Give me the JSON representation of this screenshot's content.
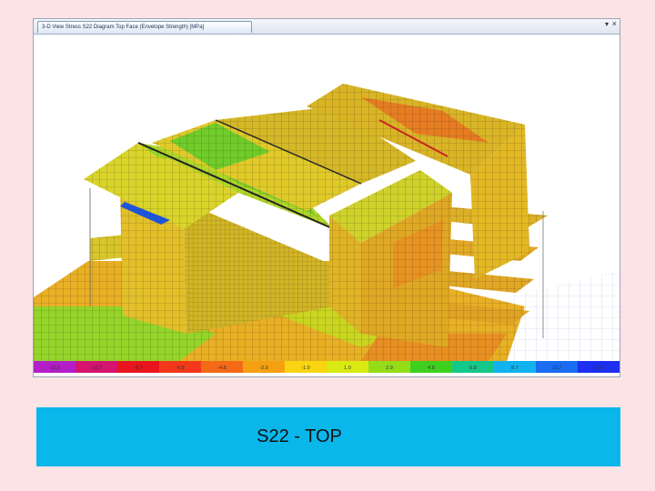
{
  "window": {
    "tab_label": "3-D View   Stress S22 Diagram  Top Face   (Envelope Strength)  [MPa]",
    "dropdown_glyph": "▾",
    "close_glyph": "×"
  },
  "legend": {
    "ticks": [
      "-12.0",
      "-10.2",
      "-8.7",
      "-6.8",
      "-4.8",
      "-2.9",
      "-1.0",
      "1.0",
      "2.9",
      "4.8",
      "6.8",
      "8.7",
      "10.7",
      "12.6"
    ],
    "colors": [
      "#b21fc7",
      "#d4146e",
      "#e8141e",
      "#f2381a",
      "#f46a16",
      "#f5a012",
      "#f8d510",
      "#d9ea12",
      "#95dc18",
      "#3ed01e",
      "#14c889",
      "#12b2ee",
      "#1a6cf0",
      "#1e2ff0"
    ]
  },
  "caption": {
    "text": "S22 - TOP"
  }
}
